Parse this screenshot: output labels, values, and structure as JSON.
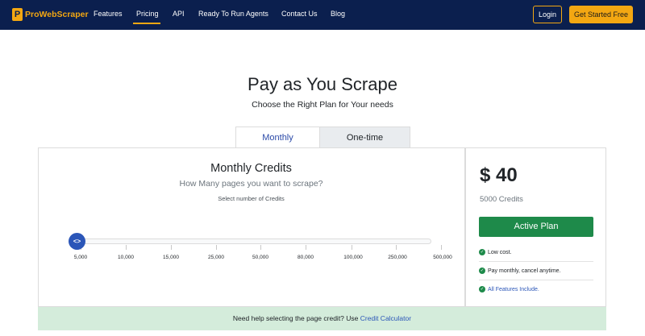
{
  "nav": {
    "logo_mark": "P",
    "logo_text": "ProWebScraper",
    "items": [
      "Features",
      "Pricing",
      "API",
      "Ready To Run Agents",
      "Contact Us",
      "Blog"
    ],
    "active_item": "Pricing",
    "login_label": "Login",
    "cta_label": "Get Started Free"
  },
  "hero": {
    "title": "Pay as You Scrape",
    "subtitle": "Choose the Right Plan for Your needs"
  },
  "tabs": {
    "monthly": "Monthly",
    "one_time": "One-time",
    "selected": "Monthly"
  },
  "credits_panel": {
    "title": "Monthly Credits",
    "subtitle": "How Many pages you want to scrape?",
    "select_label": "Select number of Credits",
    "slider_handle_glyph": "<>",
    "ticks": [
      "5,000",
      "10,000",
      "15,000",
      "25,000",
      "50,000",
      "80,000",
      "100,000",
      "250,000",
      "500,000"
    ],
    "slider_selected": "5,000"
  },
  "plan_panel": {
    "price": "$ 40",
    "credits": "5000 Credits",
    "button_label": "Active Plan",
    "features": [
      "Low cost.",
      "Pay monthly, cancel anytime.",
      "All Features Include."
    ]
  },
  "help": {
    "text": "Need help selecting the page credit? Use",
    "link": "Credit Calculator"
  },
  "colors": {
    "navbar_bg": "#0b1f4e",
    "brand_accent": "#f3a712",
    "primary_blue": "#2b56b8",
    "success_green": "#1e8a4a",
    "help_bg": "#d4ecdb"
  }
}
